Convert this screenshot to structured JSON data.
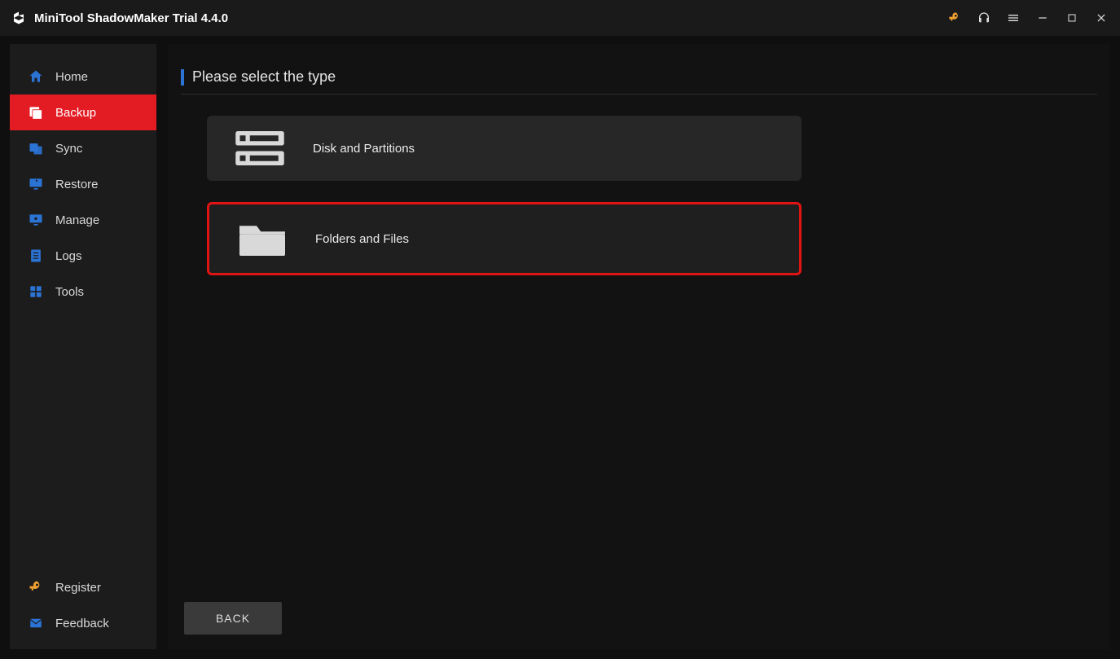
{
  "app": {
    "title": "MiniTool ShadowMaker Trial 4.4.0"
  },
  "sidebar": {
    "items": [
      {
        "label": "Home"
      },
      {
        "label": "Backup"
      },
      {
        "label": "Sync"
      },
      {
        "label": "Restore"
      },
      {
        "label": "Manage"
      },
      {
        "label": "Logs"
      },
      {
        "label": "Tools"
      }
    ],
    "bottom": [
      {
        "label": "Register"
      },
      {
        "label": "Feedback"
      }
    ]
  },
  "main": {
    "section_title": "Please select the type",
    "options": [
      {
        "label": "Disk and Partitions"
      },
      {
        "label": "Folders and Files"
      }
    ],
    "back_button": "BACK"
  }
}
